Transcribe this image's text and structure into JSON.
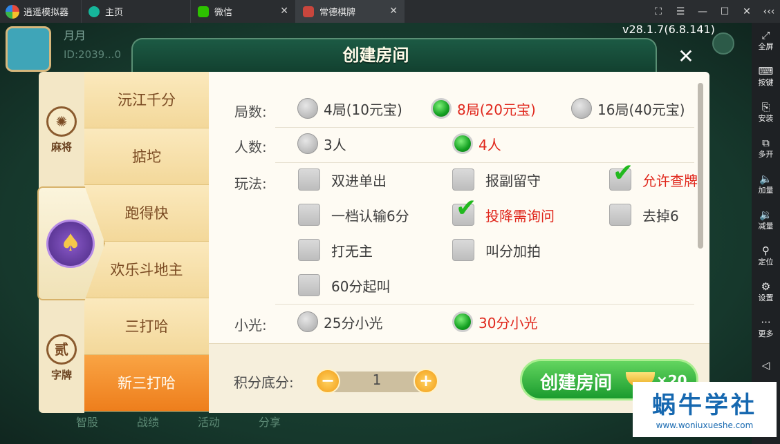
{
  "titlebar": {
    "app_name": "逍遥模拟器",
    "tabs": [
      {
        "label": "主页"
      },
      {
        "label": "微信"
      },
      {
        "label": "常德棋牌"
      }
    ],
    "close_glyph": "✕",
    "controls": {
      "fullscreen": "⛶",
      "menu": "☰",
      "minimize": "—",
      "maximize": "☐",
      "close": "✕",
      "collapse": "‹‹‹"
    }
  },
  "sidebar": {
    "items": [
      {
        "icon": "⤢",
        "label": "全屏"
      },
      {
        "icon": "⌨",
        "label": "按键"
      },
      {
        "icon": "⎘",
        "label": "安装"
      },
      {
        "icon": "⧉",
        "label": "多开"
      },
      {
        "icon": "🔈",
        "label": "加量"
      },
      {
        "icon": "🔉",
        "label": "减量"
      },
      {
        "icon": "⚲",
        "label": "定位"
      },
      {
        "icon": "⚙",
        "label": "设置"
      },
      {
        "icon": "···",
        "label": "更多"
      }
    ],
    "back_icon": "◁"
  },
  "game_bg": {
    "name": "月月",
    "id": "ID:2039...0",
    "version": "v28.1.7(6.8.141)",
    "bottom_nav": [
      "智股",
      "战绩",
      "活动",
      "分享"
    ]
  },
  "dialog": {
    "title": "创建房间",
    "close_glyph": "✕",
    "categories": [
      {
        "icon": "✺",
        "label": "麻将"
      },
      {
        "icon": "贰",
        "label": "字牌"
      }
    ],
    "spade": "♠",
    "games": [
      {
        "label": "沅江千分"
      },
      {
        "label": "掂坨"
      },
      {
        "label": "跑得快"
      },
      {
        "label": "欢乐斗地主"
      },
      {
        "label": "三打哈"
      },
      {
        "label": "新三打哈",
        "active": true
      }
    ],
    "rows": {
      "rounds": {
        "label": "局数:",
        "options": [
          "4局(10元宝)",
          "8局(20元宝)",
          "16局(40元宝)"
        ],
        "selected": "8局(20元宝)"
      },
      "players": {
        "label": "人数:",
        "options": [
          "3人",
          "4人"
        ],
        "selected": "4人"
      },
      "rules": {
        "label": "玩法:",
        "options": [
          "双进单出",
          "报副留守",
          "允许查牌",
          "一档认输6分",
          "投降需询问",
          "去掉6",
          "打无主",
          "叫分加拍",
          "60分起叫"
        ],
        "checked": [
          "允许查牌",
          "投降需询问"
        ]
      },
      "xiaoguang": {
        "label": "小光:",
        "options": [
          "25分小光",
          "30分小光"
        ],
        "selected": "30分小光"
      }
    },
    "footer": {
      "score_label": "积分底分:",
      "score_value": "1",
      "minus": "−",
      "plus": "+",
      "create_label": "创建房间",
      "cost": "×20"
    }
  },
  "watermark": {
    "main": "蜗牛学社",
    "sub": "www.woniuxueshe.com"
  },
  "colors": {
    "selected_text": "#e0271c",
    "active_game": "#f08a27",
    "create_button": "#2fae3a"
  }
}
